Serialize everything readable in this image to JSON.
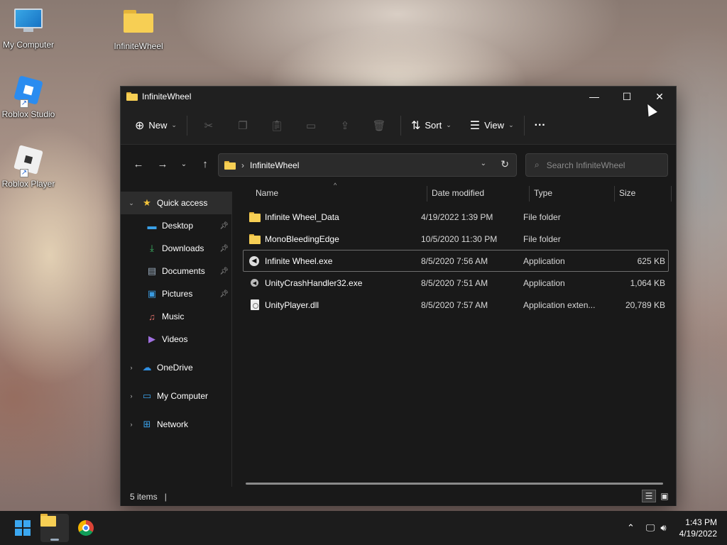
{
  "desktop": {
    "icons": [
      {
        "label": "My Computer",
        "icon": "monitor-icon"
      },
      {
        "label": "InfiniteWheel",
        "icon": "folder-icon"
      },
      {
        "label": "Roblox Studio",
        "icon": "roblox-studio-icon"
      },
      {
        "label": "Roblox Player",
        "icon": "roblox-player-icon"
      }
    ]
  },
  "window": {
    "title": "InfiniteWheel",
    "controls": {
      "minimize": "—",
      "maximize": "☐",
      "close": "✕"
    }
  },
  "toolbar": {
    "new_label": "New",
    "sort_label": "Sort",
    "view_label": "View",
    "more_label": "···",
    "icons": [
      "cut-icon",
      "copy-icon",
      "paste-icon",
      "rename-icon",
      "share-icon",
      "delete-icon"
    ]
  },
  "address": {
    "crumb": "InfiniteWheel",
    "search_placeholder": "Search InfiniteWheel"
  },
  "sidebar": {
    "quick_access": "Quick access",
    "items": [
      {
        "label": "Desktop",
        "icon": "desktop-icon",
        "pinned": true
      },
      {
        "label": "Downloads",
        "icon": "downloads-icon",
        "pinned": true
      },
      {
        "label": "Documents",
        "icon": "documents-icon",
        "pinned": true
      },
      {
        "label": "Pictures",
        "icon": "pictures-icon",
        "pinned": true
      },
      {
        "label": "Music",
        "icon": "music-icon",
        "pinned": false
      },
      {
        "label": "Videos",
        "icon": "videos-icon",
        "pinned": false
      }
    ],
    "roots": [
      {
        "label": "OneDrive",
        "icon": "onedrive-icon"
      },
      {
        "label": "My Computer",
        "icon": "computer-icon"
      },
      {
        "label": "Network",
        "icon": "network-icon"
      }
    ]
  },
  "columns": {
    "name": "Name",
    "date": "Date modified",
    "type": "Type",
    "size": "Size"
  },
  "files": [
    {
      "name": "Infinite Wheel_Data",
      "date": "4/19/2022 1:39 PM",
      "type": "File folder",
      "size": "",
      "kind": "folder"
    },
    {
      "name": "MonoBleedingEdge",
      "date": "10/5/2020 11:30 PM",
      "type": "File folder",
      "size": "",
      "kind": "folder"
    },
    {
      "name": "Infinite Wheel.exe",
      "date": "8/5/2020 7:56 AM",
      "type": "Application",
      "size": "625 KB",
      "kind": "exe"
    },
    {
      "name": "UnityCrashHandler32.exe",
      "date": "8/5/2020 7:51 AM",
      "type": "Application",
      "size": "1,064 KB",
      "kind": "exe-small"
    },
    {
      "name": "UnityPlayer.dll",
      "date": "8/5/2020 7:57 AM",
      "type": "Application exten...",
      "size": "20,789 KB",
      "kind": "dll"
    }
  ],
  "status": {
    "count": "5 items"
  },
  "taskbar": {
    "time": "1:43 PM",
    "date": "4/19/2022"
  }
}
